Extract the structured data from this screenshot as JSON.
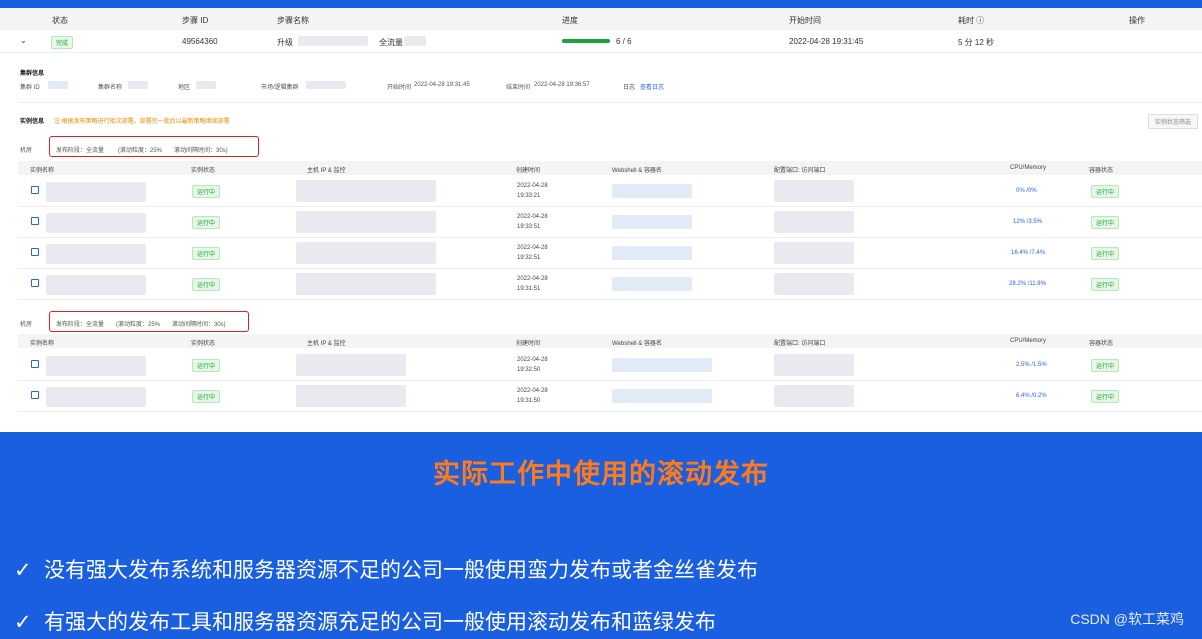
{
  "table_header": {
    "status": "状态",
    "step_id": "步骤 ID",
    "step_name": "步骤名称",
    "progress": "进度",
    "start_time": "开始时间",
    "duration": "耗时",
    "action": "操作"
  },
  "step_row": {
    "status": "完成",
    "step_id": "49564360",
    "step_name": "升级",
    "step_name_suffix": "全流量",
    "progress_text": "6 / 6",
    "progress_fraction": 1.0,
    "start_time": "2022-04-28 19:31:45",
    "duration": "5 分 12 秒"
  },
  "cluster": {
    "title": "集群信息",
    "id_label": "集群 ID",
    "name_label": "集群名称",
    "region_label": "地区",
    "logical_cluster_label": "市场/逻辑集群",
    "start_label": "开始时间",
    "start_value": "2022-04-28 19:31:45",
    "end_label": "结束时间",
    "end_value": "2022-04-28 19:36:57",
    "log_label": "日志",
    "log_link": "查看日志"
  },
  "instance": {
    "title": "实例信息",
    "notice": "注:根据发布策略进行批次部署，部署完一批后以最新策略继续部署",
    "filter_button": "实例状态筛选"
  },
  "groups": [
    {
      "room_label": "机房",
      "rollout_info": "发布阶段：全流量",
      "rollout_ratio": "(滚动粒度：25%",
      "rollout_interval": "滚动间隔时间：30s)",
      "columns": [
        "实例名称",
        "实例状态",
        "主机 IP & 监控",
        "创建时间",
        "Webshell & 容器名",
        "配置端口: 访问端口",
        "CPU/Memory",
        "容器状态"
      ],
      "rows": [
        {
          "status": "运行中",
          "date": "2022-04-28",
          "time": "19:33:21",
          "cpu": "0% /0%",
          "container": "运行中"
        },
        {
          "status": "运行中",
          "date": "2022-04-28",
          "time": "19:33:51",
          "cpu": "12% /3.5%",
          "container": "运行中"
        },
        {
          "status": "运行中",
          "date": "2022-04-28",
          "time": "19:32:51",
          "cpu": "16.4% /7.4%",
          "container": "运行中"
        },
        {
          "status": "运行中",
          "date": "2022-04-28",
          "time": "19:31:51",
          "cpu": "28.2% /11.8%",
          "container": "运行中"
        }
      ]
    },
    {
      "room_label": "机房",
      "rollout_info": "发布阶段：全流量",
      "rollout_ratio": "(滚动粒度：25%",
      "rollout_interval": "滚动间隔时间：30s)",
      "columns": [
        "实例名称",
        "实例状态",
        "主机 IP & 监控",
        "创建时间",
        "Webshell & 容器名",
        "配置端口: 访问端口",
        "CPU/Memory",
        "容器状态"
      ],
      "rows": [
        {
          "status": "运行中",
          "date": "2022-04-28",
          "time": "19:32:50",
          "cpu": "2.5% /1.5%",
          "container": "运行中"
        },
        {
          "status": "运行中",
          "date": "2022-04-28",
          "time": "19:31:50",
          "cpu": "6.4% /0.2%",
          "container": "运行中"
        }
      ]
    }
  ],
  "slide": {
    "title": "实际工作中使用的滚动发布",
    "bullets": [
      "没有强大发布系统和服务器资源不足的公司一般使用蛮力发布或者金丝雀发布",
      "有强大的发布工具和服务器资源充足的公司一般使用滚动发布和蓝绿发布"
    ],
    "check_glyph": "✓",
    "watermark": "CSDN @软工菜鸡"
  },
  "colors": {
    "background": "#1a5fe0",
    "title": "#ff7a1a",
    "running": "#1aa33a",
    "link": "#2a63e8",
    "highlight_box": "#e02020"
  }
}
